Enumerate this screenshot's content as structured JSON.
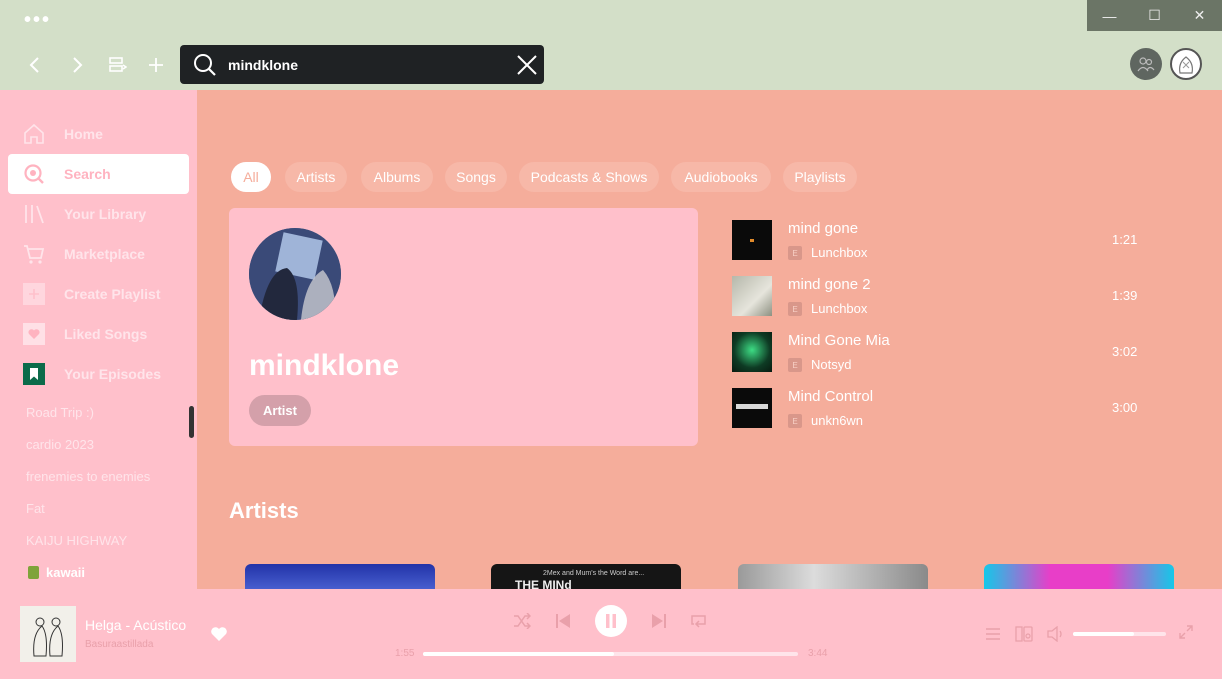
{
  "titlebar": {
    "search_value": "mindklone",
    "window_controls": {
      "minimize": "—",
      "maximize": "☐",
      "close": "✕"
    }
  },
  "sidebar": {
    "nav": [
      {
        "label": "Home",
        "icon": "home-icon"
      },
      {
        "label": "Search",
        "icon": "search-icon"
      },
      {
        "label": "Your Library",
        "icon": "library-icon"
      },
      {
        "label": "Marketplace",
        "icon": "cart-icon"
      },
      {
        "label": "Create Playlist",
        "icon": "plus-icon"
      },
      {
        "label": "Liked Songs",
        "icon": "heart-icon"
      },
      {
        "label": "Your Episodes",
        "icon": "bookmark-icon"
      }
    ],
    "playlists": [
      "Road Trip :)",
      "cardio 2023",
      "frenemies to enemies",
      "Fat",
      "KAIJU HIGHWAY",
      "kawaii"
    ]
  },
  "filters": [
    "All",
    "Artists",
    "Albums",
    "Songs",
    "Podcasts & Shows",
    "Audiobooks",
    "Playlists"
  ],
  "top_result": {
    "name": "mindklone",
    "type": "Artist"
  },
  "songs": [
    {
      "title": "mind gone",
      "artist": "Lunchbox",
      "duration": "1:21",
      "explicit": "E"
    },
    {
      "title": "mind gone 2",
      "artist": "Lunchbox",
      "duration": "1:39",
      "explicit": "E"
    },
    {
      "title": "Mind Gone Mia",
      "artist": "Notsyd",
      "duration": "3:02",
      "explicit": "E"
    },
    {
      "title": "Mind Control",
      "artist": "unkn6wn",
      "duration": "3:00",
      "explicit": "E"
    }
  ],
  "artists_section": {
    "heading": "Artists",
    "card2_text": "2Mex and Mum's the Word are...",
    "card2_big": "THE MINd"
  },
  "player": {
    "track": "Helga - Acústico",
    "artist": "Basuraastillada",
    "elapsed": "1:55",
    "total": "3:44",
    "progress": 0.51,
    "volume": 0.66
  },
  "colors": {
    "titlebar": "#d3dfc8",
    "main": "#f5ad9b",
    "sidebar": "#ffc0cb"
  }
}
